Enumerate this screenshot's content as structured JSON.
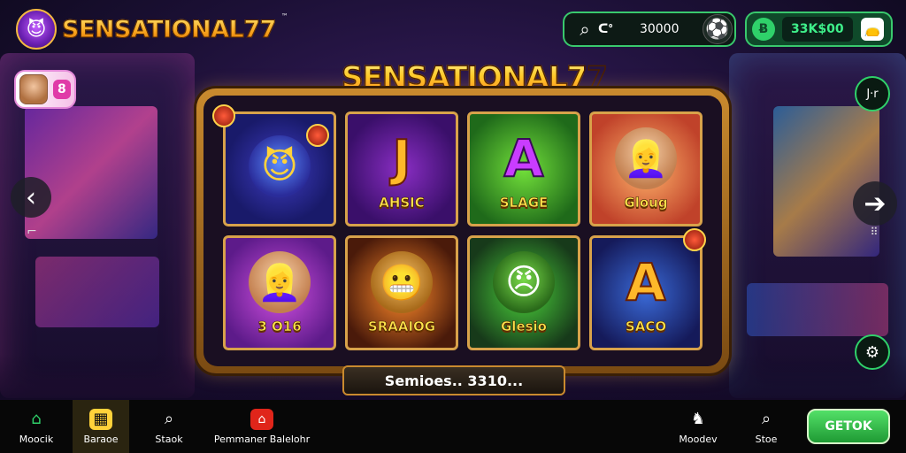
{
  "brand": {
    "name": "SENSATIONAL77",
    "tm": "™"
  },
  "search_pill": {
    "code": "ᑕᐤ",
    "value": "30000"
  },
  "wallet_pill": {
    "icon": "Ƀ",
    "amount": "33K$00"
  },
  "avatar_chip": {
    "badge": "8"
  },
  "main_title": "SENSATIONAL77",
  "tiles": [
    {
      "glyph": "",
      "label": ""
    },
    {
      "glyph": "J",
      "label": "AHSIC"
    },
    {
      "glyph": "A",
      "label": "SLAGE"
    },
    {
      "glyph": "",
      "label": "Gloug"
    },
    {
      "glyph": "",
      "label": "3 O16"
    },
    {
      "glyph": "",
      "label": "SRAAIOG"
    },
    {
      "glyph": "",
      "label": "Glesio"
    },
    {
      "glyph": "A",
      "label": "SACO"
    }
  ],
  "status_text": "Semioes.. 3310...",
  "side_buttons": {
    "top_right_label": "J·r",
    "left_arrow": "‹",
    "right_arrow": "➔"
  },
  "bottom_nav": {
    "home": "Moocik",
    "games": "Baraoe",
    "search": "Staok",
    "promo": "Pemmaner Balelohr",
    "refer": "Moodev",
    "rank": "Stoe",
    "cta": "GETOK"
  },
  "colors": {
    "accent_green": "#2fd16a",
    "gold": "#f7a21b",
    "background": "#1c1036"
  }
}
